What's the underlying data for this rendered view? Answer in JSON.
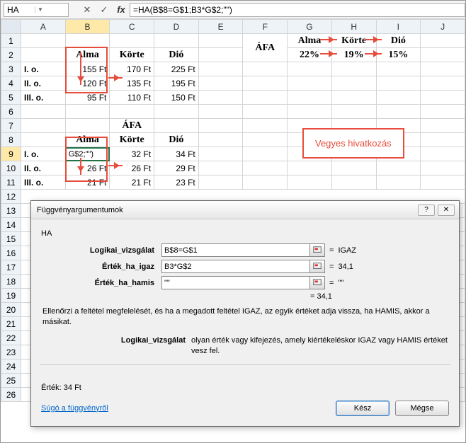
{
  "namebox": "HA",
  "formula": "=HA(B$8=G$1;B3*G$2;\"\")",
  "cols": [
    "A",
    "B",
    "C",
    "D",
    "E",
    "F",
    "G",
    "H",
    "I",
    "J"
  ],
  "rows": [
    "1",
    "2",
    "3",
    "4",
    "5",
    "6",
    "7",
    "8",
    "9",
    "10",
    "11",
    "12",
    "13",
    "14",
    "15",
    "16",
    "17",
    "18",
    "19",
    "20",
    "21",
    "22",
    "23",
    "24",
    "25",
    "26"
  ],
  "hdr1": {
    "afa": "ÁFA",
    "alma": "Alma",
    "korte": "Körte",
    "dio": "Dió"
  },
  "hdr2": {
    "p1": "22%",
    "p2": "19%",
    "p3": "15%"
  },
  "t1hdr": {
    "b": "Alma",
    "c": "Körte",
    "d": "Dió"
  },
  "t1": {
    "r3": {
      "a": "I. o.",
      "b": "155 Ft",
      "c": "170 Ft",
      "d": "225 Ft"
    },
    "r4": {
      "a": "II. o.",
      "b": "120 Ft",
      "c": "135 Ft",
      "d": "195 Ft"
    },
    "r5": {
      "a": "III. o.",
      "b": "95 Ft",
      "c": "110 Ft",
      "d": "150 Ft"
    }
  },
  "t2title": "ÁFA",
  "t2hdr": {
    "b": "Alma",
    "c": "Körte",
    "d": "Dió"
  },
  "t2": {
    "r9": {
      "a": "I. o.",
      "b": "G$2;\"\")",
      "c": "32 Ft",
      "d": "34 Ft"
    },
    "r10": {
      "a": "II. o.",
      "b": "26 Ft",
      "c": "26 Ft",
      "d": "29 Ft"
    },
    "r11": {
      "a": "III. o.",
      "b": "21 Ft",
      "c": "21 Ft",
      "d": "23 Ft"
    }
  },
  "callout": "Vegyes hivatkozás",
  "dialog": {
    "title": "Függvényargumentumok",
    "fname": "HA",
    "args": {
      "a1": {
        "label": "Logikai_vizsgálat",
        "val": "B$8=G$1",
        "res": "IGAZ"
      },
      "a2": {
        "label": "Érték_ha_igaz",
        "val": "B3*G$2",
        "res": "34,1"
      },
      "a3": {
        "label": "Érték_ha_hamis",
        "val": "\"\"",
        "res": "\"\""
      }
    },
    "result_eq": "= 34,1",
    "desc": "Ellenőrzi a feltétel megfelelését, és ha a megadott feltétel IGAZ, az egyik értéket adja vissza, ha HAMIS, akkor a másikat.",
    "desc2l": "Logikai_vizsgálat",
    "desc2r": "olyan érték vagy kifejezés, amely kiértékeléskor IGAZ vagy HAMIS értéket vesz fel.",
    "result_lbl": "Érték:  34 Ft",
    "help": "Súgó a függvényről",
    "ok": "Kész",
    "cancel": "Mégse"
  },
  "chart_data": {
    "type": "table",
    "tables": [
      {
        "title": "Árak",
        "rows": [
          "I. o.",
          "II. o.",
          "III. o."
        ],
        "cols": [
          "Alma",
          "Körte",
          "Dió"
        ],
        "values": [
          [
            155,
            170,
            225
          ],
          [
            120,
            135,
            195
          ],
          [
            95,
            110,
            150
          ]
        ],
        "unit": "Ft"
      },
      {
        "title": "ÁFA",
        "rows": [
          "I. o.",
          "II. o.",
          "III. o."
        ],
        "cols": [
          "Alma",
          "Körte",
          "Dió"
        ],
        "values": [
          [
            34,
            32,
            34
          ],
          [
            26,
            26,
            29
          ],
          [
            21,
            21,
            23
          ]
        ],
        "unit": "Ft"
      },
      {
        "title": "ÁFA kulcsok",
        "cols": [
          "Alma",
          "Körte",
          "Dió"
        ],
        "values": [
          [
            22,
            19,
            15
          ]
        ],
        "unit": "%"
      }
    ]
  }
}
